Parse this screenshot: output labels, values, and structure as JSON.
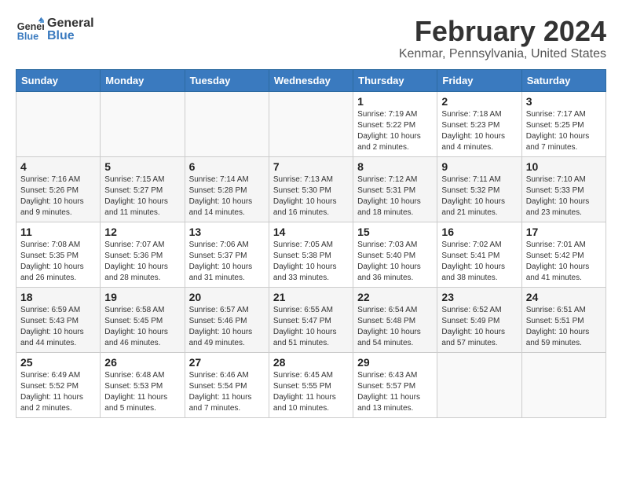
{
  "header": {
    "logo_line1": "General",
    "logo_line2": "Blue",
    "title": "February 2024",
    "subtitle": "Kenmar, Pennsylvania, United States"
  },
  "weekdays": [
    "Sunday",
    "Monday",
    "Tuesday",
    "Wednesday",
    "Thursday",
    "Friday",
    "Saturday"
  ],
  "weeks": [
    [
      {
        "day": "",
        "info": ""
      },
      {
        "day": "",
        "info": ""
      },
      {
        "day": "",
        "info": ""
      },
      {
        "day": "",
        "info": ""
      },
      {
        "day": "1",
        "info": "Sunrise: 7:19 AM\nSunset: 5:22 PM\nDaylight: 10 hours\nand 2 minutes."
      },
      {
        "day": "2",
        "info": "Sunrise: 7:18 AM\nSunset: 5:23 PM\nDaylight: 10 hours\nand 4 minutes."
      },
      {
        "day": "3",
        "info": "Sunrise: 7:17 AM\nSunset: 5:25 PM\nDaylight: 10 hours\nand 7 minutes."
      }
    ],
    [
      {
        "day": "4",
        "info": "Sunrise: 7:16 AM\nSunset: 5:26 PM\nDaylight: 10 hours\nand 9 minutes."
      },
      {
        "day": "5",
        "info": "Sunrise: 7:15 AM\nSunset: 5:27 PM\nDaylight: 10 hours\nand 11 minutes."
      },
      {
        "day": "6",
        "info": "Sunrise: 7:14 AM\nSunset: 5:28 PM\nDaylight: 10 hours\nand 14 minutes."
      },
      {
        "day": "7",
        "info": "Sunrise: 7:13 AM\nSunset: 5:30 PM\nDaylight: 10 hours\nand 16 minutes."
      },
      {
        "day": "8",
        "info": "Sunrise: 7:12 AM\nSunset: 5:31 PM\nDaylight: 10 hours\nand 18 minutes."
      },
      {
        "day": "9",
        "info": "Sunrise: 7:11 AM\nSunset: 5:32 PM\nDaylight: 10 hours\nand 21 minutes."
      },
      {
        "day": "10",
        "info": "Sunrise: 7:10 AM\nSunset: 5:33 PM\nDaylight: 10 hours\nand 23 minutes."
      }
    ],
    [
      {
        "day": "11",
        "info": "Sunrise: 7:08 AM\nSunset: 5:35 PM\nDaylight: 10 hours\nand 26 minutes."
      },
      {
        "day": "12",
        "info": "Sunrise: 7:07 AM\nSunset: 5:36 PM\nDaylight: 10 hours\nand 28 minutes."
      },
      {
        "day": "13",
        "info": "Sunrise: 7:06 AM\nSunset: 5:37 PM\nDaylight: 10 hours\nand 31 minutes."
      },
      {
        "day": "14",
        "info": "Sunrise: 7:05 AM\nSunset: 5:38 PM\nDaylight: 10 hours\nand 33 minutes."
      },
      {
        "day": "15",
        "info": "Sunrise: 7:03 AM\nSunset: 5:40 PM\nDaylight: 10 hours\nand 36 minutes."
      },
      {
        "day": "16",
        "info": "Sunrise: 7:02 AM\nSunset: 5:41 PM\nDaylight: 10 hours\nand 38 minutes."
      },
      {
        "day": "17",
        "info": "Sunrise: 7:01 AM\nSunset: 5:42 PM\nDaylight: 10 hours\nand 41 minutes."
      }
    ],
    [
      {
        "day": "18",
        "info": "Sunrise: 6:59 AM\nSunset: 5:43 PM\nDaylight: 10 hours\nand 44 minutes."
      },
      {
        "day": "19",
        "info": "Sunrise: 6:58 AM\nSunset: 5:45 PM\nDaylight: 10 hours\nand 46 minutes."
      },
      {
        "day": "20",
        "info": "Sunrise: 6:57 AM\nSunset: 5:46 PM\nDaylight: 10 hours\nand 49 minutes."
      },
      {
        "day": "21",
        "info": "Sunrise: 6:55 AM\nSunset: 5:47 PM\nDaylight: 10 hours\nand 51 minutes."
      },
      {
        "day": "22",
        "info": "Sunrise: 6:54 AM\nSunset: 5:48 PM\nDaylight: 10 hours\nand 54 minutes."
      },
      {
        "day": "23",
        "info": "Sunrise: 6:52 AM\nSunset: 5:49 PM\nDaylight: 10 hours\nand 57 minutes."
      },
      {
        "day": "24",
        "info": "Sunrise: 6:51 AM\nSunset: 5:51 PM\nDaylight: 10 hours\nand 59 minutes."
      }
    ],
    [
      {
        "day": "25",
        "info": "Sunrise: 6:49 AM\nSunset: 5:52 PM\nDaylight: 11 hours\nand 2 minutes."
      },
      {
        "day": "26",
        "info": "Sunrise: 6:48 AM\nSunset: 5:53 PM\nDaylight: 11 hours\nand 5 minutes."
      },
      {
        "day": "27",
        "info": "Sunrise: 6:46 AM\nSunset: 5:54 PM\nDaylight: 11 hours\nand 7 minutes."
      },
      {
        "day": "28",
        "info": "Sunrise: 6:45 AM\nSunset: 5:55 PM\nDaylight: 11 hours\nand 10 minutes."
      },
      {
        "day": "29",
        "info": "Sunrise: 6:43 AM\nSunset: 5:57 PM\nDaylight: 11 hours\nand 13 minutes."
      },
      {
        "day": "",
        "info": ""
      },
      {
        "day": "",
        "info": ""
      }
    ]
  ]
}
